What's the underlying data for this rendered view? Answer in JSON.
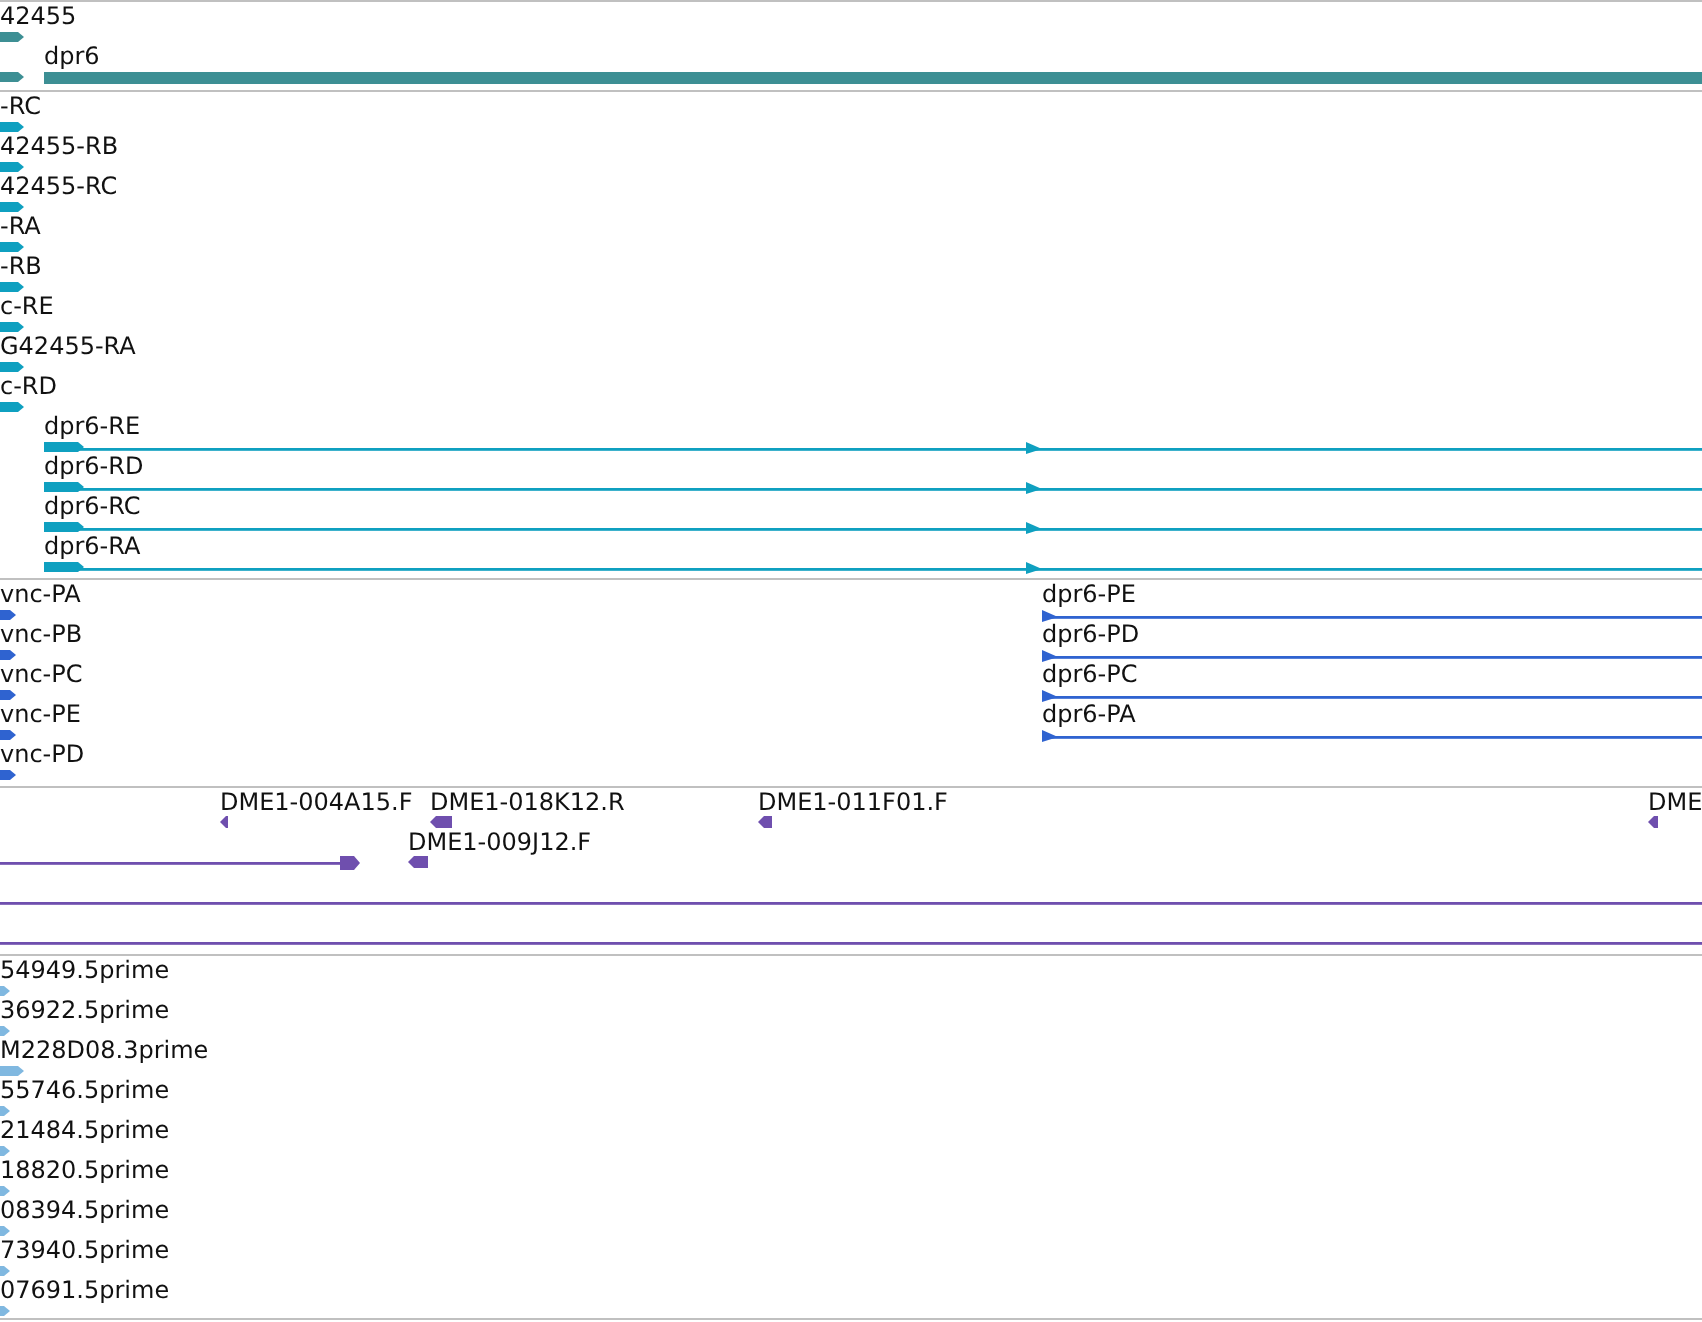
{
  "tracks": [
    {
      "kind": "genes",
      "color": "#3d8f94",
      "features": [
        {
          "label": "42455"
        },
        {
          "label": "dpr6"
        }
      ]
    },
    {
      "kind": "transcripts",
      "color": "#0fa0c0",
      "features": [
        {
          "label": "-RC"
        },
        {
          "label": "42455-RB"
        },
        {
          "label": "42455-RC"
        },
        {
          "label": "-RA"
        },
        {
          "label": "-RB"
        },
        {
          "label": "c-RE"
        },
        {
          "label": "G42455-RA"
        },
        {
          "label": "c-RD"
        },
        {
          "label": "dpr6-RE"
        },
        {
          "label": "dpr6-RD"
        },
        {
          "label": "dpr6-RC"
        },
        {
          "label": "dpr6-RA"
        }
      ]
    },
    {
      "kind": "proteins",
      "color": "#2f63d0",
      "features": [
        {
          "label": "vnc-PA"
        },
        {
          "label": "dpr6-PE"
        },
        {
          "label": "vnc-PB"
        },
        {
          "label": "dpr6-PD"
        },
        {
          "label": "vnc-PC"
        },
        {
          "label": "dpr6-PC"
        },
        {
          "label": "vnc-PE"
        },
        {
          "label": "dpr6-PA"
        },
        {
          "label": "vnc-PD"
        }
      ]
    },
    {
      "kind": "clones",
      "color": "#6f4fae",
      "features": [
        {
          "label": "DME1-004A15.F"
        },
        {
          "label": "DME1-018K12.R"
        },
        {
          "label": "DME1-011F01.F"
        },
        {
          "label": "DME"
        },
        {
          "label": "DME1-009J12.F"
        }
      ]
    },
    {
      "kind": "ests",
      "color": "#80b8e0",
      "features": [
        {
          "label": "54949.5prime"
        },
        {
          "label": "36922.5prime"
        },
        {
          "label": "M228D08.3prime"
        },
        {
          "label": "55746.5prime"
        },
        {
          "label": "21484.5prime"
        },
        {
          "label": "18820.5prime"
        },
        {
          "label": "08394.5prime"
        },
        {
          "label": "73940.5prime"
        },
        {
          "label": "07691.5prime"
        }
      ]
    }
  ]
}
